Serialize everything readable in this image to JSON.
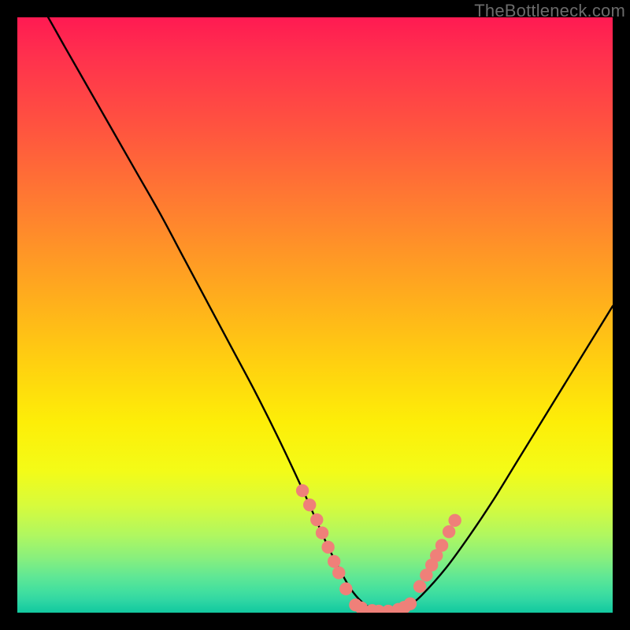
{
  "watermark": "TheBottleneck.com",
  "colors": {
    "curve": "#000000",
    "dot": "#ef8079",
    "gradient_top": "#ff1a52",
    "gradient_bottom": "#13c99f"
  },
  "chart_data": {
    "type": "line",
    "title": "",
    "xlabel": "",
    "ylabel": "",
    "xlim": [
      0,
      100
    ],
    "ylim": [
      0,
      100
    ],
    "series": [
      {
        "name": "bottleneck-curve",
        "x": [
          0,
          4,
          8,
          12,
          16,
          20,
          24,
          28,
          32,
          36,
          40,
          44,
          48,
          50,
          52,
          54,
          56,
          58,
          60,
          62,
          64,
          66,
          68,
          72,
          76,
          80,
          84,
          88,
          92,
          96,
          100
        ],
        "y": [
          108,
          102,
          95,
          88,
          81,
          74,
          67,
          59.5,
          52,
          44.5,
          37,
          29,
          20.5,
          16,
          11.5,
          7.5,
          4,
          1.7,
          0.5,
          0.2,
          0.5,
          1.4,
          3,
          7.5,
          13,
          19,
          25.5,
          32,
          38.5,
          45,
          51.5
        ]
      }
    ],
    "dot_series": [
      {
        "name": "left-arm-dots",
        "x": [
          47.9,
          49.1,
          50.3,
          51.2,
          52.2,
          53.2,
          54.0,
          55.2
        ],
        "y": [
          20.5,
          18.1,
          15.6,
          13.4,
          11.0,
          8.6,
          6.7,
          4.0
        ]
      },
      {
        "name": "valley-dots",
        "x": [
          56.8,
          57.8,
          59.6,
          60.7,
          62.3,
          64.0,
          65.0,
          66.0
        ],
        "y": [
          1.3,
          0.8,
          0.35,
          0.25,
          0.25,
          0.55,
          0.9,
          1.5
        ]
      },
      {
        "name": "right-arm-dots",
        "x": [
          67.6,
          68.7,
          69.6,
          70.4,
          71.3,
          72.5,
          73.5
        ],
        "y": [
          4.4,
          6.3,
          8.0,
          9.6,
          11.3,
          13.6,
          15.5
        ]
      }
    ]
  }
}
